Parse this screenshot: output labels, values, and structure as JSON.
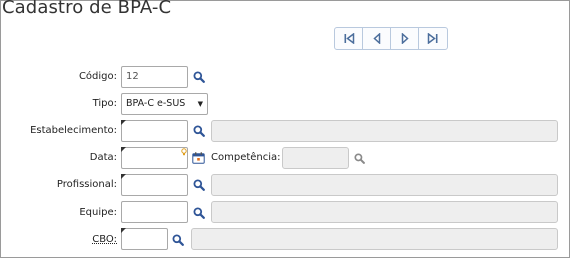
{
  "page": {
    "title": "Cadastro de BPA-C"
  },
  "nav": {
    "first_icon": "first-record-icon",
    "prev_icon": "previous-record-icon",
    "next_icon": "next-record-icon",
    "last_icon": "last-record-icon"
  },
  "form": {
    "codigo": {
      "label": "Código:",
      "value": "12"
    },
    "tipo": {
      "label": "Tipo:",
      "selected": "BPA-C e-SUS"
    },
    "estabelecimento": {
      "label": "Estabelecimento:",
      "value": "",
      "description": ""
    },
    "data": {
      "label": "Data:",
      "value": ""
    },
    "competencia": {
      "label": "Competência:",
      "value": ""
    },
    "profissional": {
      "label": "Profissional:",
      "value": "",
      "description": ""
    },
    "equipe": {
      "label": "Equipe:",
      "value": "",
      "description": ""
    },
    "cbo": {
      "label": "CBO:",
      "value": "",
      "description": ""
    }
  },
  "colors": {
    "icon": "#2f5597",
    "nav_icon": "#4c6e9c",
    "readonly_bg": "#eeeeee",
    "border": "#a9a9a9"
  }
}
